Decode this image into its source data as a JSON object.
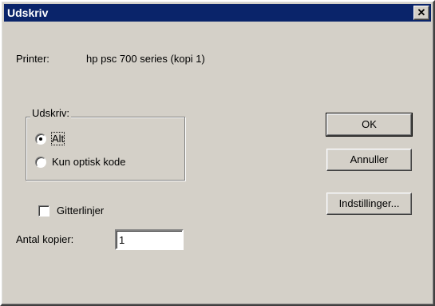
{
  "window": {
    "title": "Udskriv",
    "close_symbol": "✕"
  },
  "printer": {
    "label": "Printer:",
    "value": "hp psc 700 series (kopi 1)"
  },
  "print_range": {
    "legend": "Udskriv:",
    "options": [
      {
        "label": "Alt",
        "checked": true
      },
      {
        "label": "Kun optisk kode",
        "checked": false
      }
    ]
  },
  "gridlines": {
    "label": "Gitterlinjer",
    "checked": false
  },
  "copies": {
    "label": "Antal kopier:",
    "value": "1"
  },
  "buttons": {
    "ok": "OK",
    "cancel": "Annuller",
    "settings": "Indstillinger..."
  }
}
